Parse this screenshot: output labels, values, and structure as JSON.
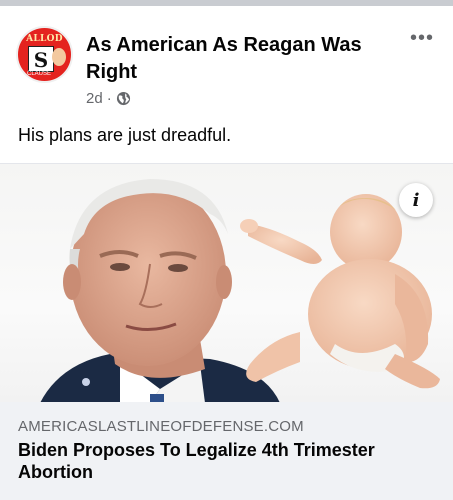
{
  "post": {
    "page_name": "As American As Reagan Was Right",
    "time": "2d",
    "separator": "·",
    "more_label": "•••",
    "text": "His plans are just dreadful.",
    "avatar": {
      "top_word": "ALLOD",
      "badge_letter": "S",
      "small_top": "SATIRE",
      "bottom_word": "CLAUSE"
    }
  },
  "link_preview": {
    "domain": "AMERICASLASTLINEOFDEFENSE.COM",
    "title": "Biden Proposes To Legalize 4th Trimester Abortion",
    "info_label": "i"
  },
  "icons": {
    "globe": "globe-icon",
    "more": "more-icon",
    "info": "info-icon"
  },
  "colors": {
    "secondary_text": "#65676b",
    "footer_bg": "#f0f2f5",
    "avatar_red": "#e4231f"
  }
}
